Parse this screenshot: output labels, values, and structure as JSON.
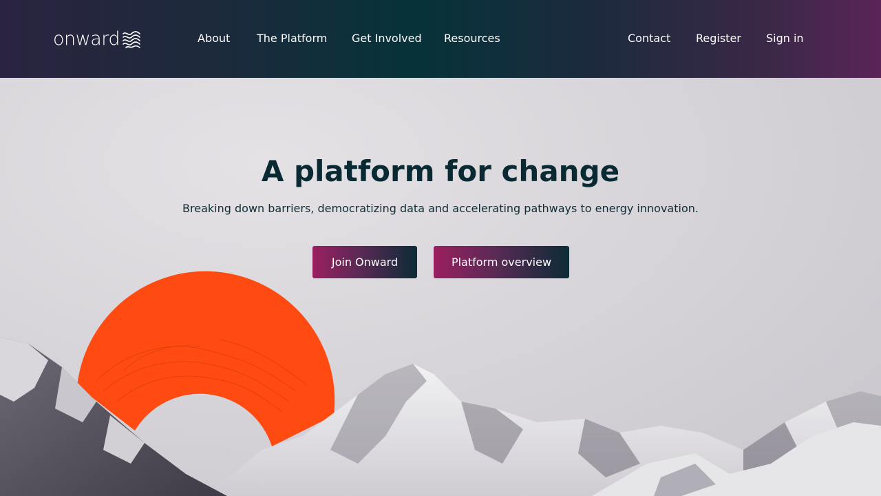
{
  "brand": {
    "name": "onward"
  },
  "nav": {
    "about": "About",
    "platform": "The Platform",
    "involved": "Get Involved",
    "resources": "Resources",
    "contact": "Contact",
    "register": "Register",
    "signin": "Sign in"
  },
  "hero": {
    "title": "A platform for change",
    "subtitle": "Breaking down barriers, democratizing data and accelerating pathways to energy innovation.",
    "primary_cta": "Join Onward",
    "secondary_cta": "Platform overview"
  },
  "colors": {
    "accent_magenta": "#9a1f60",
    "deep_teal": "#0a2a33",
    "orange_arc": "#ff4a12"
  }
}
